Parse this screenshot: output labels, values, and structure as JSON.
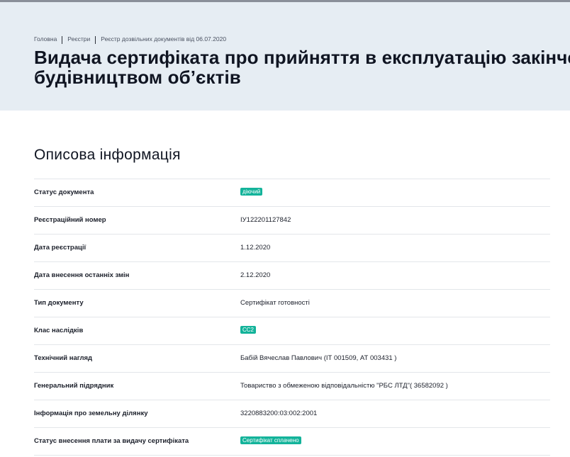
{
  "breadcrumb": {
    "items": [
      "Головна",
      "Реєстри",
      "Реєстр дозвільних документів від 06.07.2020"
    ]
  },
  "page_title": "Видача сертифіката про прийняття в експлуатацію закінчених будівництвом об’єктів",
  "page_title_lines": [
    "Видача сертифіката про прийняття в експлуатацію закінчених",
    "будівництвом об’єктів"
  ],
  "section_title": "Описова інформація",
  "colors": {
    "hero_bg": "#e6edf3",
    "badge_green": "#13b39a"
  },
  "rows": [
    {
      "label": "Статус документа",
      "value": "діючий",
      "badge": true
    },
    {
      "label": "Реєстраційний номер",
      "value": "ІУ122201127842",
      "badge": false
    },
    {
      "label": "Дата реєстрації",
      "value": "1.12.2020",
      "badge": false
    },
    {
      "label": "Дата внесення останніх змін",
      "value": "2.12.2020",
      "badge": false
    },
    {
      "label": "Тип документу",
      "value": "Сертифікат готовності",
      "badge": false
    },
    {
      "label": "Клас наслідків",
      "value": "СС2",
      "badge": true
    },
    {
      "label": "Технічний нагляд",
      "value": "Бабій Вячеслав Павлович (ІТ 001509, АТ 003431 )",
      "badge": false
    },
    {
      "label": "Генеральний підрядник",
      "value": "Товариство з обмеженою відповідальністю \"РБС ЛТД\"( 36582092 )",
      "badge": false
    },
    {
      "label": "Інформація про земельну ділянку",
      "value": "3220883200:03:002:2001",
      "badge": false
    },
    {
      "label": "Статус внесення плати за видачу сертифіката",
      "value": "Сертифікат сплачено",
      "badge": true
    }
  ]
}
